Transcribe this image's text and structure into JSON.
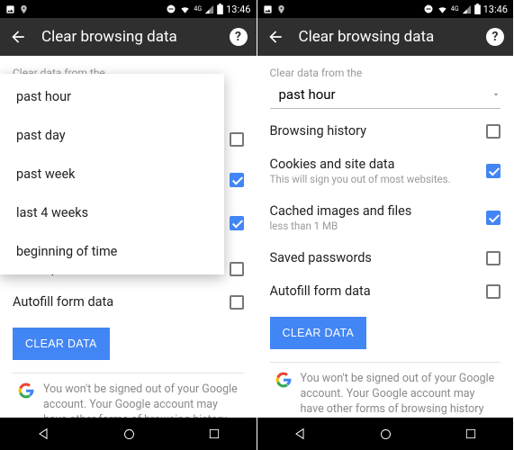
{
  "statusbar": {
    "time": "13:46"
  },
  "appbar": {
    "title": "Clear browsing data"
  },
  "section_label": "Clear data from the",
  "time_select": {
    "value": "past hour",
    "options": [
      "past hour",
      "past day",
      "past week",
      "last 4 weeks",
      "beginning of time"
    ]
  },
  "items": [
    {
      "title": "Browsing history",
      "sub": "",
      "checked": false
    },
    {
      "title": "Cookies and site data",
      "sub": "This will sign you out of most websites.",
      "checked": true
    },
    {
      "title": "Cached images and files",
      "sub": "less than 1 MB",
      "checked": true
    },
    {
      "title": "Saved passwords",
      "sub": "",
      "checked": false
    },
    {
      "title": "Autofill form data",
      "sub": "",
      "checked": false
    }
  ],
  "clear_button": "CLEAR DATA",
  "notice": "You won't be signed out of your Google account. Your Google account may have other forms of browsing history at"
}
